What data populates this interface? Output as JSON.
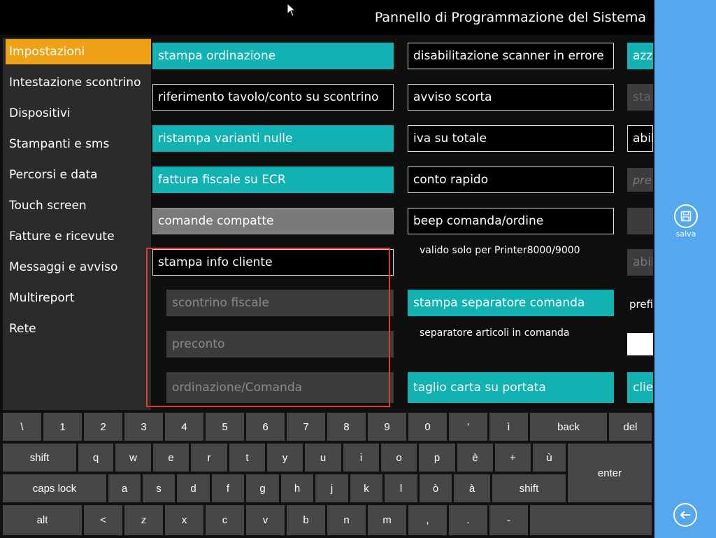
{
  "header": {
    "title": "Pannello di Programmazione del Sistema"
  },
  "sidebar": {
    "items": [
      {
        "label": "Impostazioni",
        "active": true
      },
      {
        "label": "Intestazione scontrino"
      },
      {
        "label": "Dispositivi"
      },
      {
        "label": "Stampanti e sms"
      },
      {
        "label": "Percorsi e data"
      },
      {
        "label": "Touch screen"
      },
      {
        "label": "Fatture e ricevute"
      },
      {
        "label": "Messaggi e avviso"
      },
      {
        "label": "Multireport"
      },
      {
        "label": "Rete"
      }
    ]
  },
  "settings": {
    "col1": {
      "stampa_ordinazione": "stampa ordinazione",
      "riferimento_tavolo": "riferimento tavolo/conto su scontrino",
      "ristampa_varianti": "ristampa varianti nulle",
      "fattura_fiscale": "fattura fiscale su ECR",
      "comande_compatte": "comande compatte",
      "stampa_info_cliente": "stampa info cliente",
      "scontrino_fiscale": "scontrino fiscale",
      "preconto": "preconto",
      "ordinazione_comanda": "ordinazione/Comanda"
    },
    "col2": {
      "disabilitazione_scanner": "disabilitazione scanner in errore",
      "avviso_scorta": "avviso scorta",
      "iva_su_totale": "iva su totale",
      "conto_rapido": "conto rapido",
      "beep_comanda": "beep comanda/ordine",
      "beep_note": "valido solo per Printer8000/9000",
      "stampa_separatore": "stampa separatore comanda",
      "separatore_note": "separatore articoli in comanda",
      "taglio_carta": "taglio carta su portata"
    },
    "col3": {
      "r1": "azz",
      "r2": "star",
      "r3": "abil",
      "r4": "pref",
      "r6": "abil",
      "r7": "prefi",
      "r9": "clie"
    }
  },
  "actions": {
    "save_label": "salva"
  },
  "icons": {
    "save": "save-icon",
    "back": "back-arrow-icon",
    "cursor": "mouse-pointer-icon"
  },
  "keyboard": {
    "row1": [
      "\\",
      "1",
      "2",
      "3",
      "4",
      "5",
      "6",
      "7",
      "8",
      "9",
      "0",
      "'",
      "ì",
      "back",
      "del"
    ],
    "row2": [
      "shift",
      "q",
      "w",
      "e",
      "r",
      "t",
      "y",
      "u",
      "i",
      "o",
      "p",
      "è",
      "+",
      "ù"
    ],
    "row3": [
      "caps lock",
      "a",
      "s",
      "d",
      "f",
      "g",
      "h",
      "j",
      "k",
      "l",
      "ò",
      "à",
      "shift"
    ],
    "row4": [
      "alt",
      "<",
      "z",
      "x",
      "c",
      "v",
      "b",
      "n",
      "m",
      ",",
      ".",
      "-"
    ],
    "enter": "enter"
  },
  "colors": {
    "accent_orange": "#f0a116",
    "teal": "#12b2b2",
    "rightbar_blue": "#55a8ee",
    "highlight_red": "#e03b2c"
  }
}
